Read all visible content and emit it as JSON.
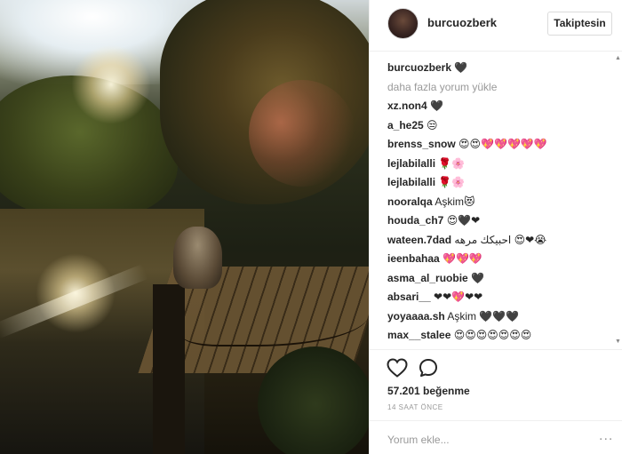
{
  "post": {
    "author": "burcuozberk",
    "follow_label": "Takiptesin",
    "caption_user": "burcuozberk",
    "caption_text": "🖤",
    "load_more": "daha fazla yorum yükle",
    "comments": [
      {
        "user": "xz.non4",
        "text": "🖤"
      },
      {
        "user": "a_he25",
        "text": "😒"
      },
      {
        "user": "brenss_snow",
        "text": "😍😍💖💖💖💖💖"
      },
      {
        "user": "lejlabilalli",
        "text": "🌹🌸"
      },
      {
        "user": "lejlabilalli",
        "text": "🌹🌸"
      },
      {
        "user": "nooralqa",
        "text": "Aşkim😻"
      },
      {
        "user": "houda_ch7",
        "text": "😍🖤❤"
      },
      {
        "user": "wateen.7dad",
        "text": "احبيكك مرهه 😍❤😭"
      },
      {
        "user": "ieenbahaa",
        "text": "💖💖💖"
      },
      {
        "user": "asma_al_ruobie",
        "text": "🖤"
      },
      {
        "user": "absari__",
        "text": "❤❤💖❤❤"
      },
      {
        "user": "yoyaaaa.sh",
        "text": "Aşkim 🖤🖤🖤"
      },
      {
        "user": "max__stalee",
        "text": "😍😍😍😍😍😍😍"
      }
    ],
    "likes": "57.201 beğenme",
    "time": "14 SAAT ÖNCE",
    "add_comment_placeholder": "Yorum ekle...",
    "more_icon": "..."
  },
  "icons": {
    "like": "heart-outline-icon",
    "comment": "speech-bubble-icon",
    "more": "ellipsis-icon"
  },
  "colors": {
    "text": "#262626",
    "muted": "#999999",
    "border": "#efefef"
  }
}
